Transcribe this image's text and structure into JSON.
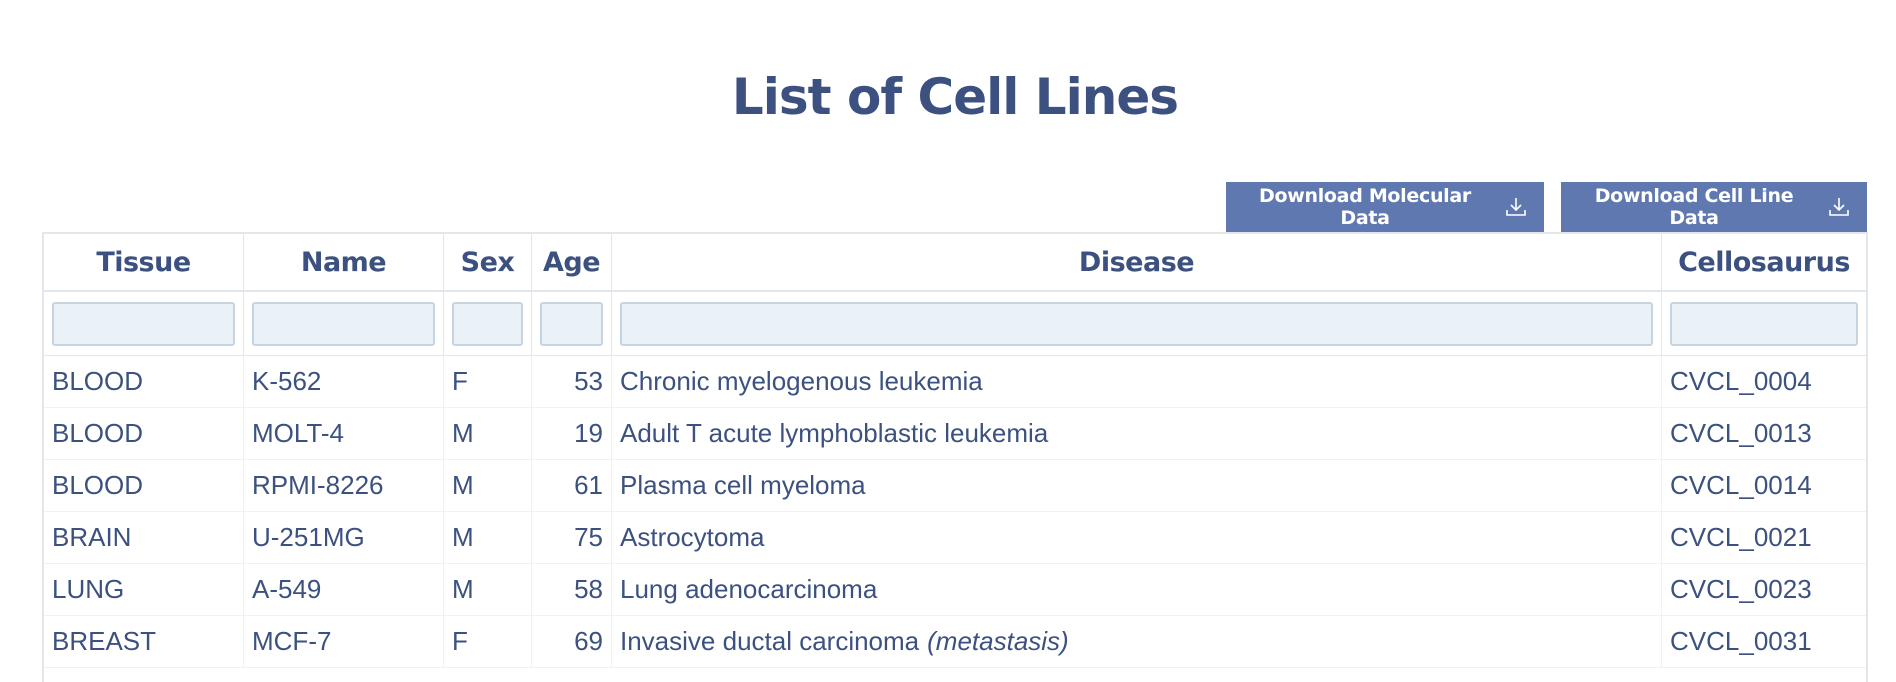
{
  "page": {
    "title": "List of Cell Lines"
  },
  "buttons": {
    "molecular": "Download Molecular Data",
    "cell_line": "Download Cell Line Data"
  },
  "table": {
    "columns": [
      "Tissue",
      "Name",
      "Sex",
      "Age",
      "Disease",
      "Cellosaurus"
    ],
    "rows": [
      {
        "tissue": "BLOOD",
        "name": "K-562",
        "sex": "F",
        "age": "53",
        "disease": "Chronic myelogenous leukemia",
        "note": "",
        "cvcl": "CVCL_0004"
      },
      {
        "tissue": "BLOOD",
        "name": "MOLT-4",
        "sex": "M",
        "age": "19",
        "disease": "Adult T acute lymphoblastic leukemia",
        "note": "",
        "cvcl": "CVCL_0013"
      },
      {
        "tissue": "BLOOD",
        "name": "RPMI-8226",
        "sex": "M",
        "age": "61",
        "disease": "Plasma cell myeloma",
        "note": "",
        "cvcl": "CVCL_0014"
      },
      {
        "tissue": "BRAIN",
        "name": "U-251MG",
        "sex": "M",
        "age": "75",
        "disease": "Astrocytoma",
        "note": "",
        "cvcl": "CVCL_0021"
      },
      {
        "tissue": "LUNG",
        "name": "A-549",
        "sex": "M",
        "age": "58",
        "disease": "Lung adenocarcinoma",
        "note": "",
        "cvcl": "CVCL_0023"
      },
      {
        "tissue": "BREAST",
        "name": "MCF-7",
        "sex": "F",
        "age": "69",
        "disease": "Invasive ductal carcinoma",
        "note": "(metastasis)",
        "cvcl": "CVCL_0031"
      }
    ]
  },
  "icons": {
    "download": "download-icon"
  },
  "colors": {
    "accent": "#6078b0",
    "text": "#3c5180",
    "filter_bg": "#eaf2f8"
  }
}
